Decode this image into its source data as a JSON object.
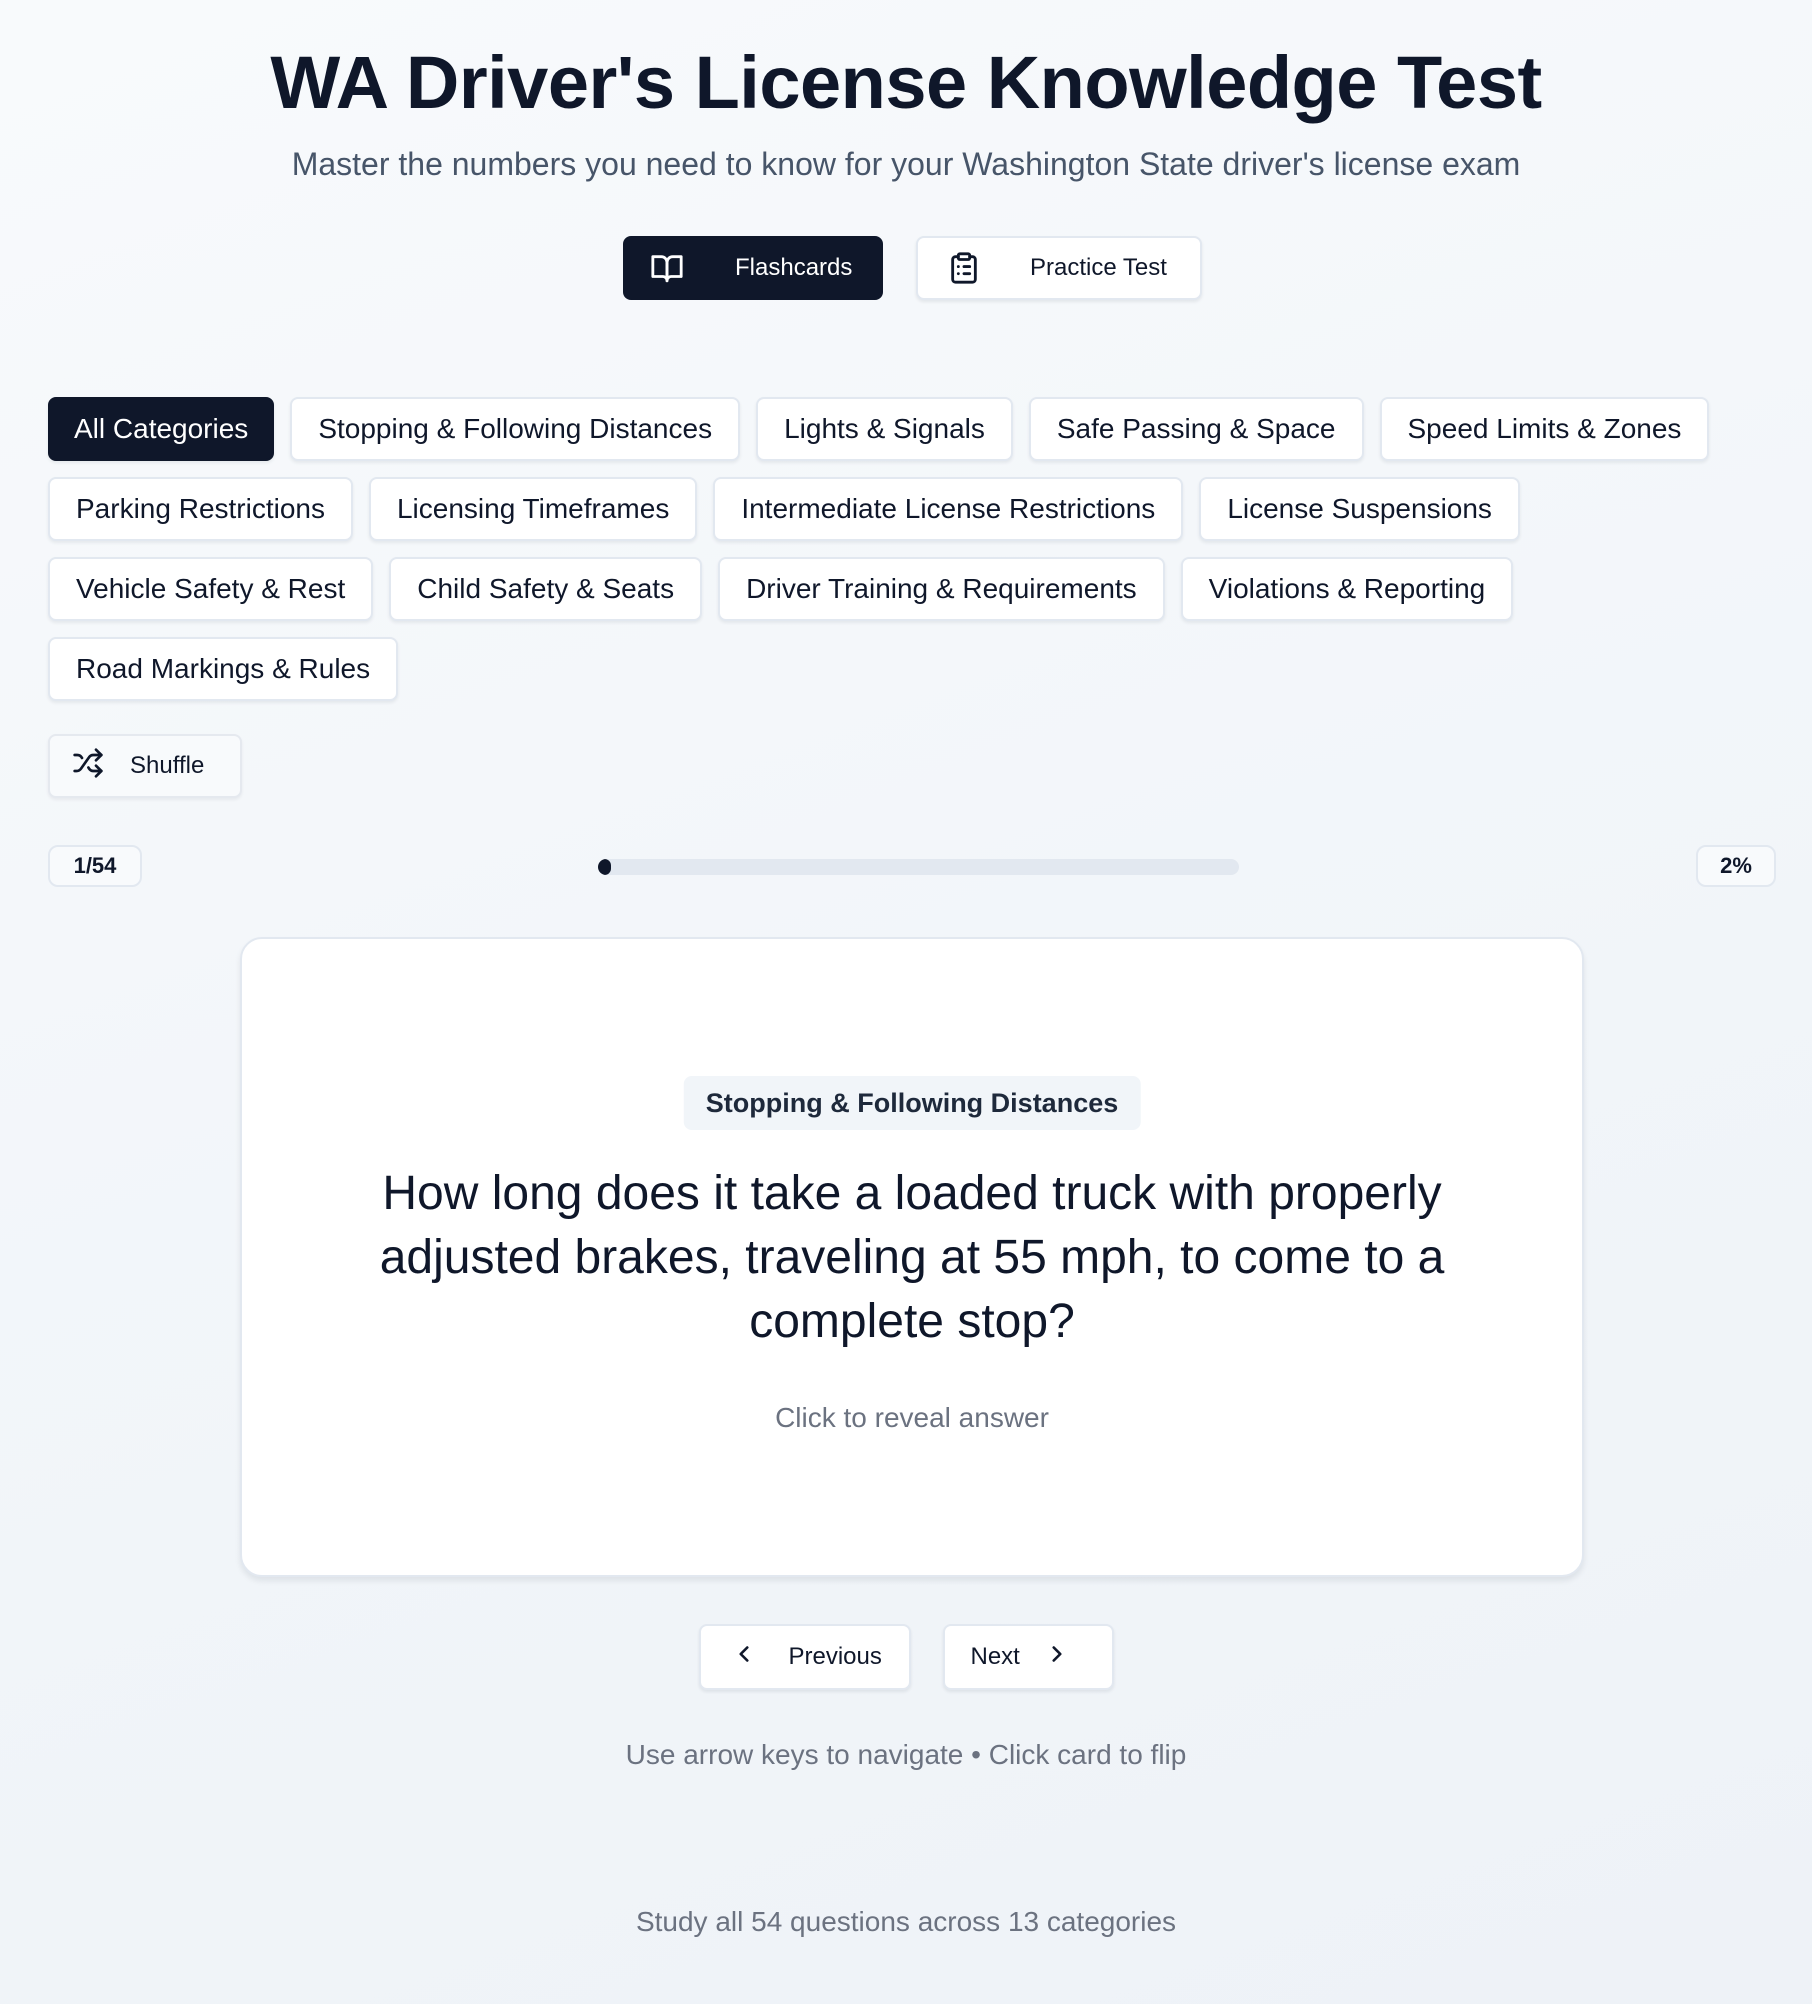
{
  "header": {
    "title": "WA Driver's License Knowledge Test",
    "subtitle": "Master the numbers you need to know for your Washington State driver's license exam"
  },
  "modes": [
    {
      "label": "Flashcards",
      "icon": "book-open-icon",
      "active": true
    },
    {
      "label": "Practice Test",
      "icon": "clipboard-list-icon",
      "active": false
    }
  ],
  "categories": [
    {
      "label": "All Categories",
      "active": true
    },
    {
      "label": "Stopping & Following Distances",
      "active": false
    },
    {
      "label": "Lights & Signals",
      "active": false
    },
    {
      "label": "Safe Passing & Space",
      "active": false
    },
    {
      "label": "Speed Limits & Zones",
      "active": false
    },
    {
      "label": "Parking Restrictions",
      "active": false
    },
    {
      "label": "Licensing Timeframes",
      "active": false
    },
    {
      "label": "Intermediate License Restrictions",
      "active": false
    },
    {
      "label": "License Suspensions",
      "active": false
    },
    {
      "label": "Vehicle Safety & Rest",
      "active": false
    },
    {
      "label": "Child Safety & Seats",
      "active": false
    },
    {
      "label": "Driver Training & Requirements",
      "active": false
    },
    {
      "label": "Violations & Reporting",
      "active": false
    },
    {
      "label": "Road Markings & Rules",
      "active": false
    }
  ],
  "shuffle": {
    "label": "Shuffle",
    "icon": "shuffle-icon"
  },
  "progress": {
    "counter": "1/54",
    "percent_label": "2%",
    "fraction": 0.02
  },
  "card": {
    "category": "Stopping & Following Distances",
    "question": "How long does it take a loaded truck with properly adjusted brakes, traveling at 55 mph, to come to a complete stop?",
    "hint": "Click to reveal answer"
  },
  "navigation": {
    "previous_label": "Previous",
    "next_label": "Next",
    "hint": "Use arrow keys to navigate • Click card to flip"
  },
  "footer": {
    "text": "Study all 54 questions across 13 categories"
  },
  "colors": {
    "primary": "#0f172a",
    "border": "#e2e8f0",
    "muted_text": "#6b7280",
    "track": "#e2e8f0"
  }
}
